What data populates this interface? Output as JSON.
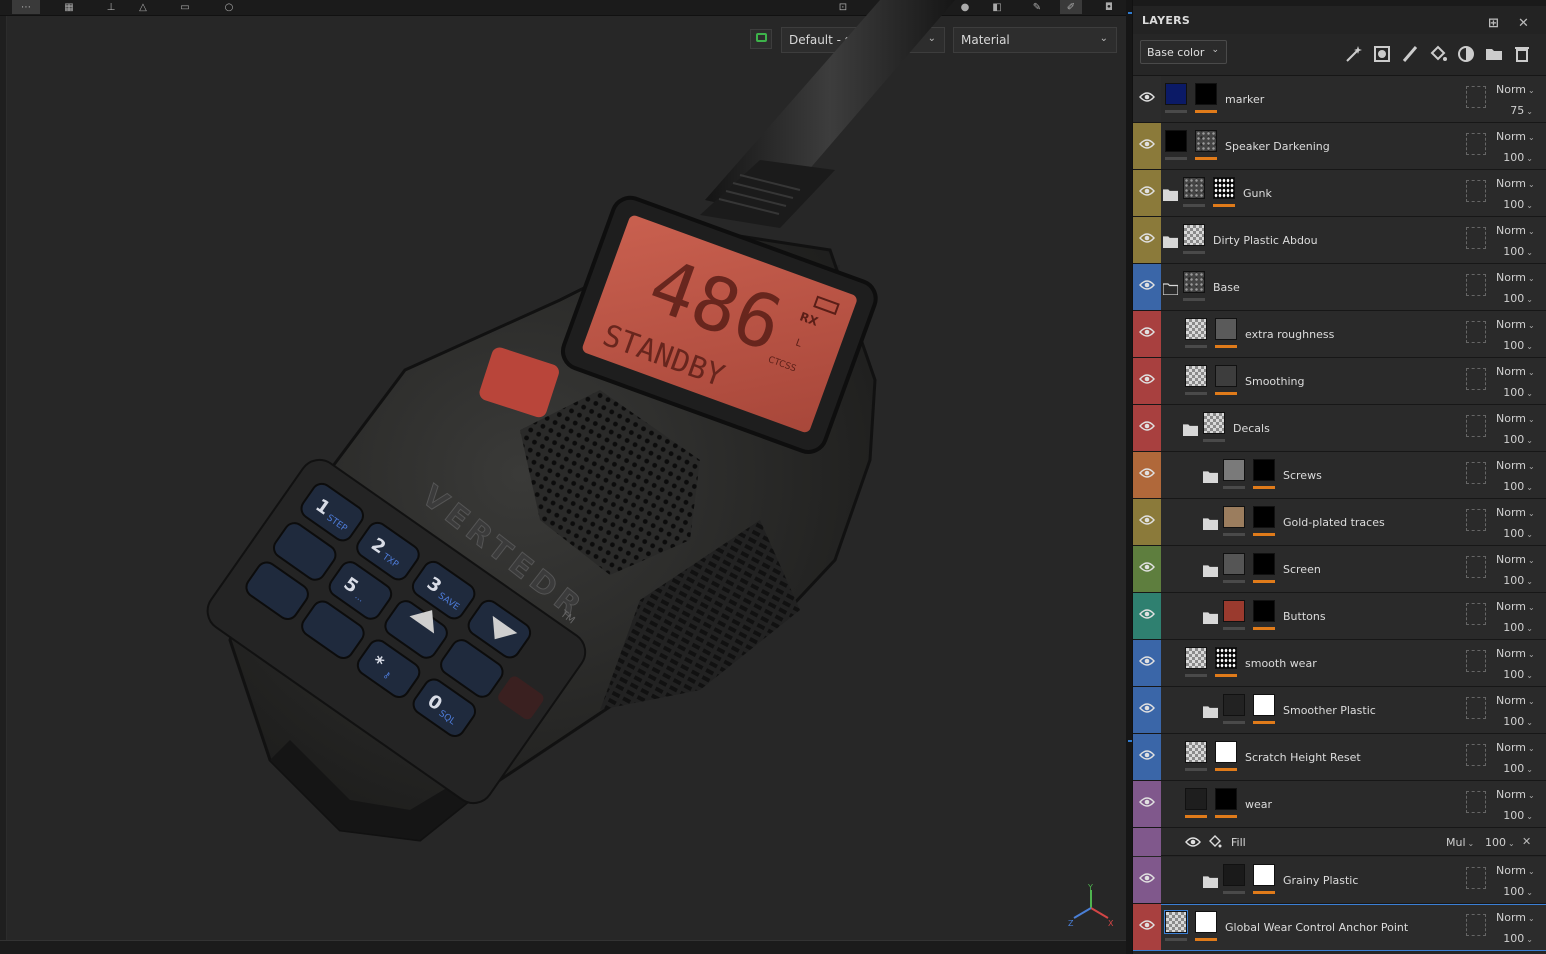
{
  "viewport": {
    "colorspace_select": "Default - sRGB",
    "display_select": "Material",
    "radio": {
      "display_number": "486",
      "display_status": "STANDBY",
      "lcd_rx": "RX",
      "lcd_l": "L",
      "lcd_ctcss": "CTCSS",
      "brand": "VERTEDR",
      "trademark": "TM",
      "keys": [
        {
          "label": "1",
          "sub": "STEP"
        },
        {
          "label": "2",
          "sub": "TXP"
        },
        {
          "label": "3",
          "sub": "SAVE"
        },
        {
          "label": "5",
          "sub": "..."
        },
        {
          "label": "*",
          "sub": "⚷"
        },
        {
          "label": "0",
          "sub": "SQL"
        }
      ]
    },
    "gizmo": {
      "x": "X",
      "y": "Y",
      "z": "Z"
    }
  },
  "panel": {
    "title": "LAYERS",
    "channel": "Base color",
    "tool_icons": [
      "magic-wand-icon",
      "smart-mask-icon",
      "paint-brush-icon",
      "fill-bucket-icon",
      "effect-icon",
      "folder-add-icon",
      "trash-icon"
    ],
    "layers": [
      {
        "name": "marker",
        "color": "#2c2c2c",
        "opacity": "75",
        "blend": "Norm"
      },
      {
        "name": "Speaker Darkening",
        "color": "#8b7a3a",
        "opacity": "100",
        "blend": "Norm"
      },
      {
        "name": "Gunk",
        "color": "#8b7a3a",
        "opacity": "100",
        "blend": "Norm"
      },
      {
        "name": "Dirty Plastic Abdou",
        "color": "#8b7a3a",
        "opacity": "100",
        "blend": "Norm"
      },
      {
        "name": "Base",
        "color": "#3a66a8",
        "opacity": "100",
        "blend": "Norm"
      },
      {
        "name": "extra roughness",
        "color": "#a8403f",
        "opacity": "100",
        "blend": "Norm"
      },
      {
        "name": "Smoothing",
        "color": "#a8403f",
        "opacity": "100",
        "blend": "Norm"
      },
      {
        "name": "Decals",
        "color": "#a8403f",
        "opacity": "100",
        "blend": "Norm"
      },
      {
        "name": "Screws",
        "color": "#b0683a",
        "opacity": "100",
        "blend": "Norm"
      },
      {
        "name": "Gold-plated traces",
        "color": "#8b7a3a",
        "opacity": "100",
        "blend": "Norm"
      },
      {
        "name": "Screen",
        "color": "#5e7e3e",
        "opacity": "100",
        "blend": "Norm"
      },
      {
        "name": "Buttons",
        "color": "#2f8070",
        "opacity": "100",
        "blend": "Norm"
      },
      {
        "name": "smooth wear",
        "color": "#3a66a8",
        "opacity": "100",
        "blend": "Norm"
      },
      {
        "name": "Smoother Plastic",
        "color": "#3a66a8",
        "opacity": "100",
        "blend": "Norm"
      },
      {
        "name": "Scratch Height Reset",
        "color": "#3a66a8",
        "opacity": "100",
        "blend": "Norm"
      },
      {
        "name": "wear",
        "color": "#80588c",
        "opacity": "100",
        "blend": "Norm"
      },
      {
        "name": "Grainy Plastic",
        "color": "#80588c",
        "opacity": "100",
        "blend": "Norm"
      },
      {
        "name": "Global Wear Control Anchor Point",
        "color": "#a8403f",
        "opacity": "100",
        "blend": "Norm"
      }
    ],
    "fill_effect": {
      "name": "Fill",
      "blend": "Mul",
      "opacity": "100"
    }
  }
}
